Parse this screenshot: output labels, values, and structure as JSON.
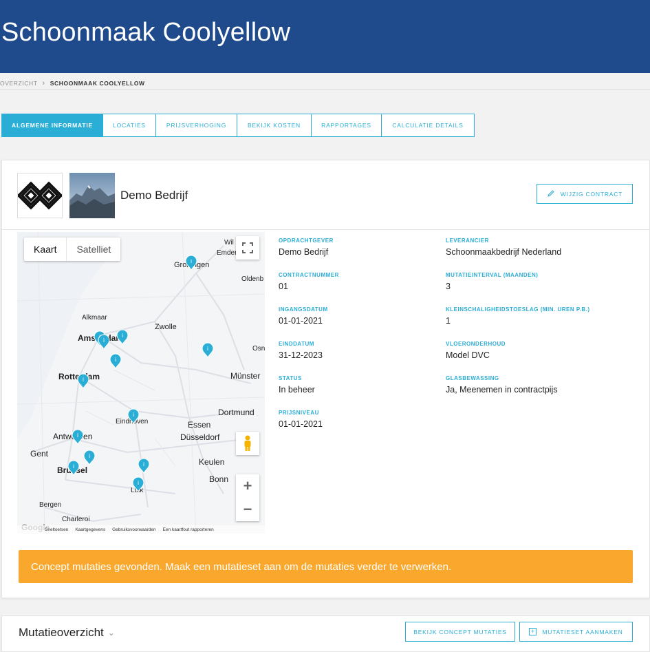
{
  "header": {
    "title": "Schoonmaak Coolyellow"
  },
  "breadcrumb": {
    "items": [
      "OVERZICHT",
      "SCHOONMAAK COOLYELLOW"
    ]
  },
  "tabs": [
    {
      "label": "ALGEMENE INFORMATIE",
      "active": true
    },
    {
      "label": "LOCATIES",
      "active": false
    },
    {
      "label": "PRIJSVERHOGING",
      "active": false
    },
    {
      "label": "BEKIJK KOSTEN",
      "active": false
    },
    {
      "label": "RAPPORTAGES",
      "active": false
    },
    {
      "label": "CALCULATIE DETAILS",
      "active": false
    }
  ],
  "contract": {
    "company_name": "Demo Bedrijf",
    "edit_button": "WIJZIG CONTRACT",
    "fields_left": [
      {
        "label": "OPDRACHTGEVER",
        "value": "Demo Bedrijf"
      },
      {
        "label": "CONTRACTNUMMER",
        "value": "01"
      },
      {
        "label": "INGANGSDATUM",
        "value": "01-01-2021"
      },
      {
        "label": "EINDDATUM",
        "value": "31-12-2023"
      },
      {
        "label": "STATUS",
        "value": "In beheer"
      },
      {
        "label": "PRIJSNIVEAU",
        "value": "01-01-2021"
      }
    ],
    "fields_right": [
      {
        "label": "LEVERANCIER",
        "value": "Schoonmaakbedrijf Nederland"
      },
      {
        "label": "MUTATIEINTERVAL (MAANDEN)",
        "value": "3"
      },
      {
        "label": "KLEINSCHALIGHEIDSTOESLAG (MIN. UREN P.B.)",
        "value": "1"
      },
      {
        "label": "VLOERONDERHOUD",
        "value": "Model DVC"
      },
      {
        "label": "GLASBEWASSING",
        "value": "Ja, Meenemen in contractpijs"
      }
    ]
  },
  "map": {
    "type_map": "Kaart",
    "type_satellite": "Satelliet",
    "cities": [
      "Wil",
      "Emder",
      "Groningen",
      "Oldenb",
      "Alkmaar",
      "Amsterdam",
      "Zwolle",
      "Osn",
      "Rotterdam",
      "Münster",
      "Dortmund",
      "Eindhoven",
      "Essen",
      "Antwerpen",
      "Düsseldorf",
      "Gent",
      "Keulen",
      "Brussel",
      "Bonn",
      "Luik",
      "Bergen",
      "Charleroi"
    ],
    "footer": [
      "Sneltoetsen",
      "Kaartgegevens",
      "Gebruiksvoorwaarden",
      "Een kaartfout rapporteren"
    ],
    "google": "Google",
    "marker_label": "i",
    "marker_color": "#2aaed6"
  },
  "alert": {
    "text": "Concept mutaties gevonden. Maak een mutatieset aan om de mutaties verder te verwerken.",
    "color": "#f9a82d"
  },
  "mutations": {
    "title": "Mutatieoverzicht",
    "concept_button": "BEKIJK CONCEPT MUTATIES",
    "create_button": "MUTATIESET AANMAKEN"
  },
  "colors": {
    "header_bg": "#1f4a8c",
    "accent": "#2aaed6"
  }
}
